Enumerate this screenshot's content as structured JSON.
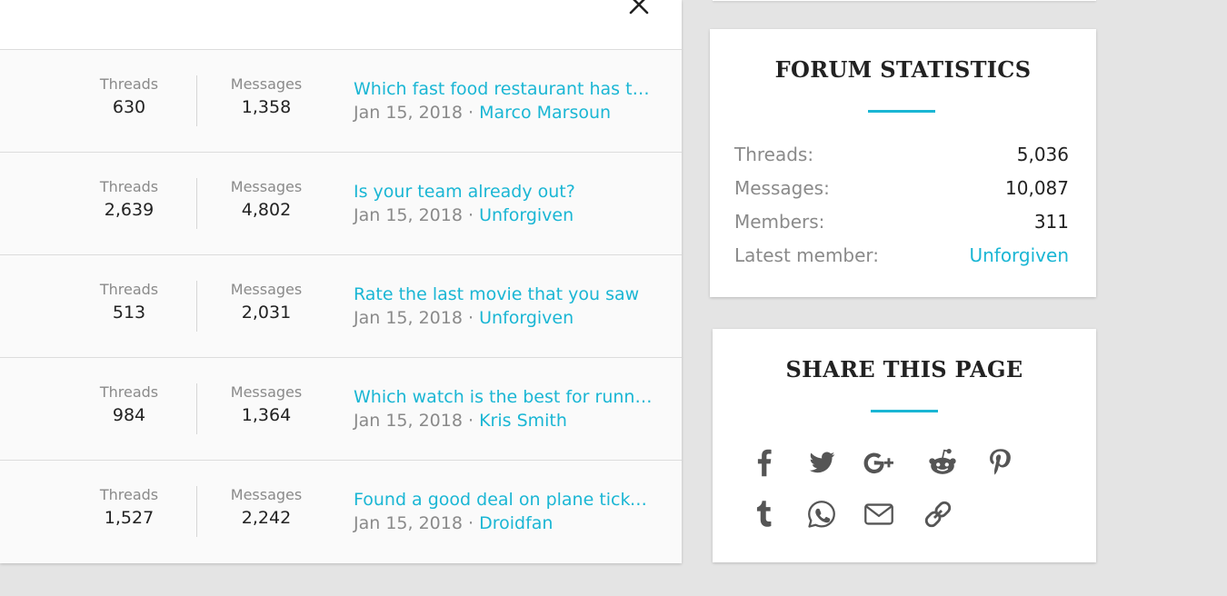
{
  "forum_nodes": [
    {
      "threads_label": "Threads",
      "threads": "630",
      "messages_label": "Messages",
      "messages": "1,358",
      "latest_title": "Which fast food restaurant has the best fries?",
      "latest_date": "Jan 15, 2018",
      "latest_user": "Marco Marsoun"
    },
    {
      "threads_label": "Threads",
      "threads": "2,639",
      "messages_label": "Messages",
      "messages": "4,802",
      "latest_title": "Is your team already out?",
      "latest_date": "Jan 15, 2018",
      "latest_user": "Unforgiven"
    },
    {
      "threads_label": "Threads",
      "threads": "513",
      "messages_label": "Messages",
      "messages": "2,031",
      "latest_title": "Rate the last movie that you saw",
      "latest_date": "Jan 15, 2018",
      "latest_user": "Unforgiven"
    },
    {
      "threads_label": "Threads",
      "threads": "984",
      "messages_label": "Messages",
      "messages": "1,364",
      "latest_title": "Which watch is the best for running?",
      "latest_date": "Jan 15, 2018",
      "latest_user": "Kris Smith"
    },
    {
      "threads_label": "Threads",
      "threads": "1,527",
      "messages_label": "Messages",
      "messages": "2,242",
      "latest_title": "Found a good deal on plane tickets",
      "latest_date": "Jan 15, 2018",
      "latest_user": "Droidfan"
    }
  ],
  "meta_separator": "·",
  "forum_statistics": {
    "title": "FORUM STATISTICS",
    "rows": [
      {
        "label": "Threads:",
        "value": "5,036"
      },
      {
        "label": "Messages:",
        "value": "10,087"
      },
      {
        "label": "Members:",
        "value": "311"
      },
      {
        "label": "Latest member:",
        "value": "Unforgiven"
      }
    ]
  },
  "share_page": {
    "title": "SHARE THIS PAGE",
    "icons": [
      "facebook-icon",
      "twitter-icon",
      "google-plus-icon",
      "reddit-icon",
      "pinterest-icon",
      "tumblr-icon",
      "whatsapp-icon",
      "email-icon",
      "link-icon"
    ]
  },
  "colors": {
    "accent": "#1ab6d4",
    "icon_gray": "#555555",
    "muted_text": "#8a8a8a",
    "background": "#e4e4e4"
  }
}
